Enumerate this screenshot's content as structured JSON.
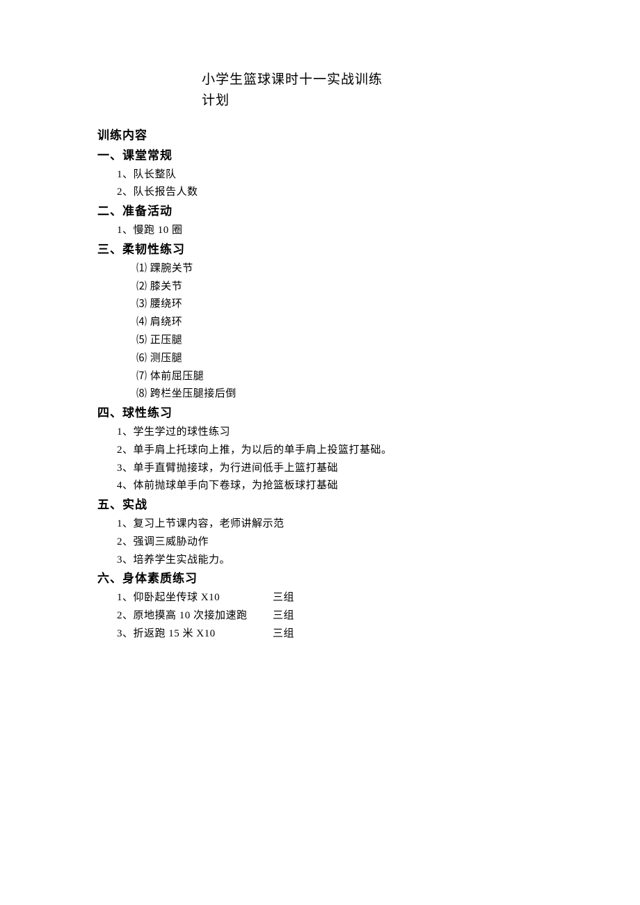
{
  "title_line1": "小学生篮球课时十一实战训练",
  "title_line2": "计划",
  "main_heading": "训练内容",
  "sections": {
    "s1": {
      "heading": "一、课堂常规",
      "items": [
        "1、队长整队",
        "2、队长报告人数"
      ]
    },
    "s2": {
      "heading": "二、准备活动",
      "items": [
        "1、慢跑 10 圈"
      ]
    },
    "s3": {
      "heading": "三、柔韧性练习",
      "subitems": [
        "⑴ 踝腕关节",
        "⑵ 膝关节",
        "⑶ 腰绕环",
        "⑷ 肩绕环",
        "⑸ 正压腿",
        "⑹ 测压腿",
        "⑺ 体前屈压腿",
        "⑻ 跨栏坐压腿接后倒"
      ]
    },
    "s4": {
      "heading": "四、球性练习",
      "items": [
        "1、学生学过的球性练习",
        "2、单手肩上托球向上推，为以后的单手肩上投篮打基础。",
        "3、单手直臂抛接球，为行进间低手上篮打基础",
        "4、体前抛球单手向下卷球，为抢篮板球打基础"
      ]
    },
    "s5": {
      "heading": "五、实战",
      "items": [
        "1、复习上节课内容，老师讲解示范",
        "2、强调三威胁动作",
        "3、培养学生实战能力。"
      ]
    },
    "s6": {
      "heading": "六、身体素质练习",
      "rows": [
        {
          "c1": "1、仰卧起坐传球 X10",
          "c2": "三组"
        },
        {
          "c1": "2、原地摸高 10 次接加速跑",
          "c2": "三组"
        },
        {
          "c1": "3、折返跑 15 米 X10",
          "c2": "三组"
        }
      ]
    }
  }
}
